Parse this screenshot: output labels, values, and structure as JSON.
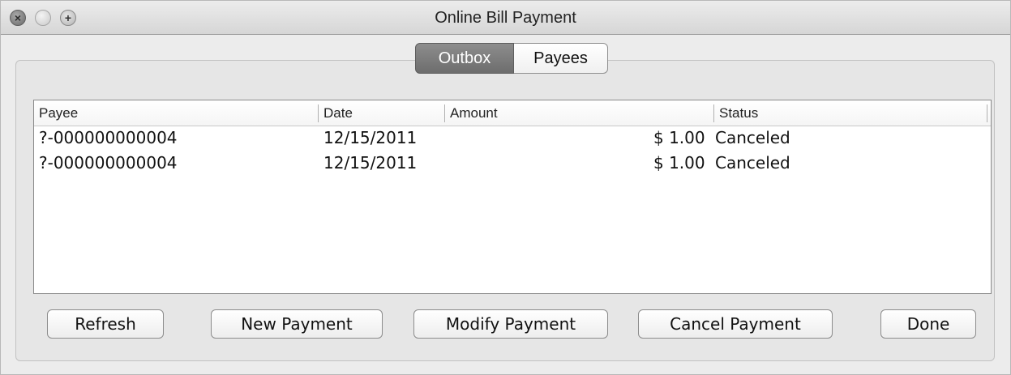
{
  "window": {
    "title": "Online Bill Payment"
  },
  "tabs": [
    {
      "label": "Outbox",
      "selected": true
    },
    {
      "label": "Payees",
      "selected": false
    }
  ],
  "table": {
    "columns": [
      "Payee",
      "Date",
      "Amount",
      "Status"
    ],
    "rows": [
      {
        "payee": "?-000000000004",
        "date": "12/15/2011",
        "amount": "$ 1.00",
        "status": "Canceled"
      },
      {
        "payee": "?-000000000004",
        "date": "12/15/2011",
        "amount": "$ 1.00",
        "status": "Canceled"
      }
    ]
  },
  "buttons": {
    "refresh": "Refresh",
    "new_payment": "New Payment",
    "modify_payment": "Modify Payment",
    "cancel_payment": "Cancel Payment",
    "done": "Done"
  }
}
